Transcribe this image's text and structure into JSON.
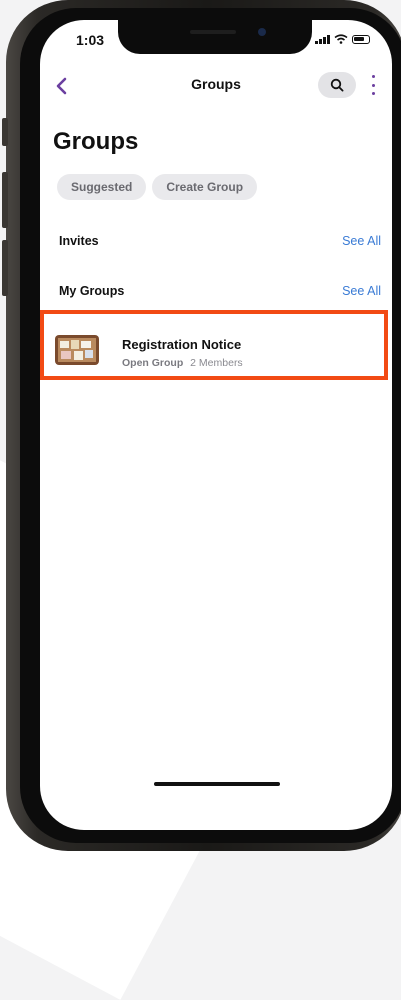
{
  "status_bar": {
    "time": "1:03"
  },
  "top_bar": {
    "title": "Groups",
    "back_icon": "chevron-left-icon",
    "search_icon": "search-icon",
    "more_icon": "more-vertical-icon",
    "accent_color": "#6b3fa0"
  },
  "page": {
    "title": "Groups"
  },
  "chips": [
    {
      "label": "Suggested"
    },
    {
      "label": "Create Group"
    }
  ],
  "sections": {
    "invites": {
      "label": "Invites",
      "see_all": "See All"
    },
    "my_groups": {
      "label": "My Groups",
      "see_all": "See All"
    }
  },
  "groups": [
    {
      "name": "Registration Notice",
      "type": "Open Group",
      "members": "2 Members"
    }
  ],
  "colors": {
    "link": "#3a7bd5",
    "highlight": "#f24a14"
  }
}
